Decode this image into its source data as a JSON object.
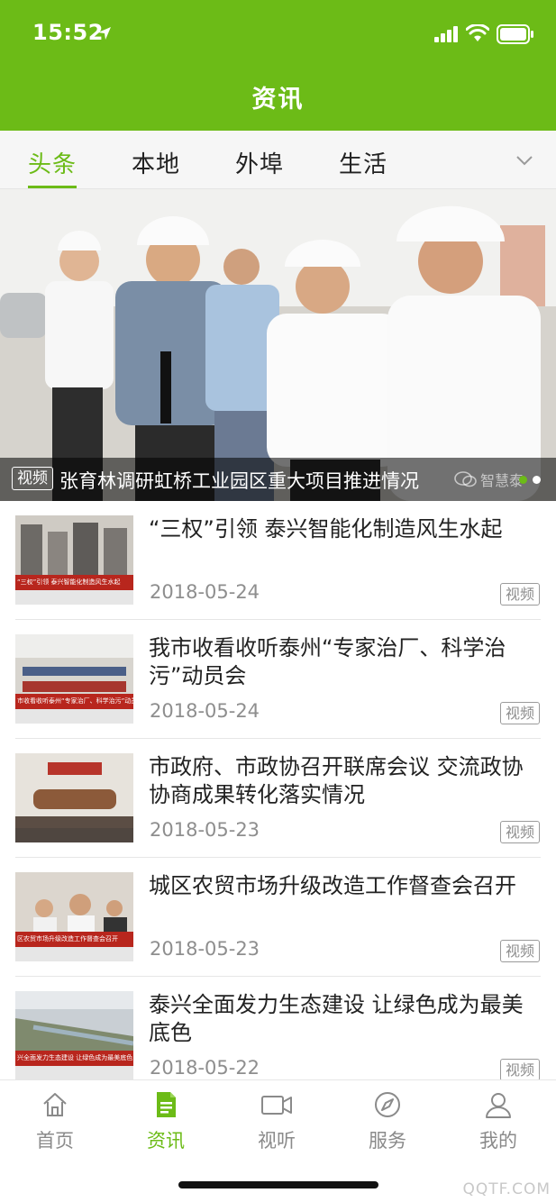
{
  "status_bar": {
    "time": "15:52"
  },
  "header": {
    "title": "资讯"
  },
  "tabs": [
    {
      "label": "头条",
      "active": true
    },
    {
      "label": "本地",
      "active": false
    },
    {
      "label": "外埠",
      "active": false
    },
    {
      "label": "生活",
      "active": false
    }
  ],
  "banner": {
    "badge": "视频",
    "title": "张育林调研虹桥工业园区重大项目推进情况",
    "watermark": "智慧泰",
    "slides_total": 2,
    "slide_active": 1
  },
  "news": [
    {
      "title": "“三权”引领 泰兴智能化制造风生水起",
      "date": "2018-05-24",
      "badge": "视频",
      "thumb_caption": "“三权”引领 泰兴智能化制造风生水起"
    },
    {
      "title": "我市收看收听泰州“专家治厂、科学治污”动员会",
      "date": "2018-05-24",
      "badge": "视频",
      "thumb_caption": "市收看收听泰州“专家治厂、科学治污”动员会"
    },
    {
      "title": "市政府、市政协召开联席会议 交流政协协商成果转化落实情况",
      "date": "2018-05-23",
      "badge": "视频",
      "thumb_caption": ""
    },
    {
      "title": "城区农贸市场升级改造工作督查会召开",
      "date": "2018-05-23",
      "badge": "视频",
      "thumb_caption": "区农贸市场升级改造工作督查会召开"
    },
    {
      "title": "泰兴全面发力生态建设 让绿色成为最美底色",
      "date": "2018-05-22",
      "badge": "视频",
      "thumb_caption": "兴全面发力生态建设 让绿色成为最美底色"
    }
  ],
  "bottom_nav": [
    {
      "label": "首页",
      "icon": "home-icon",
      "active": false
    },
    {
      "label": "资讯",
      "icon": "document-icon",
      "active": true
    },
    {
      "label": "视听",
      "icon": "video-camera-icon",
      "active": false
    },
    {
      "label": "服务",
      "icon": "compass-icon",
      "active": false
    },
    {
      "label": "我的",
      "icon": "user-icon",
      "active": false
    }
  ],
  "site_watermark": "QQTF.COM",
  "colors": {
    "brand": "#6cbb17",
    "badge_border": "#9a9a9a",
    "text_muted": "#8e8e8e"
  }
}
